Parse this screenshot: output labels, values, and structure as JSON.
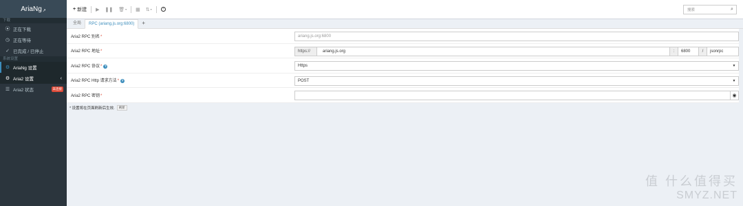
{
  "brand": {
    "name": "AriaNg",
    "suffix": "↗"
  },
  "sidebar": {
    "sections": [
      {
        "header": "下载",
        "items": [
          {
            "icon": "play-circle-icon",
            "glyph": "⦿",
            "label": "正在下载"
          },
          {
            "icon": "clock-icon",
            "glyph": "◷",
            "label": "正在等待"
          },
          {
            "icon": "check-circle-icon",
            "glyph": "✓",
            "label": "已完成 / 已停止"
          }
        ]
      },
      {
        "header": "系统设置",
        "items": [
          {
            "icon": "gear-icon",
            "glyph": "⚙",
            "label": "AriaNg 设置"
          },
          {
            "icon": "gears-icon",
            "glyph": "⚙",
            "label": "Aria2 设置"
          },
          {
            "icon": "list-icon",
            "glyph": "☰",
            "label": "Aria2 状态",
            "badge": "未连接"
          }
        ]
      }
    ]
  },
  "toolbar": {
    "new_label": "新建",
    "search_placeholder": "搜索"
  },
  "tabs": [
    "全局",
    "RPC (ariang.js.org:6800)",
    "+"
  ],
  "form": {
    "alias": {
      "label": "Aria2 RPC 别名",
      "placeholder": "ariang.js.org:6800"
    },
    "address": {
      "label": "Aria2 RPC 地址",
      "protocol": "https://",
      "host": "ariang.js.org",
      "sep1": ":",
      "port": "6800",
      "sep2": "/",
      "path": "jsonrpc"
    },
    "protocol": {
      "label": "Aria2 RPC 协议",
      "value": "Https"
    },
    "method": {
      "label": "Aria2 RPC Http 请求方法",
      "value": "POST"
    },
    "secret": {
      "label": "Aria2 RPC 密钥",
      "value": ""
    }
  },
  "note": {
    "text": "* 设置将在页面刷新后生效.",
    "button": "刷新"
  },
  "watermark": {
    "line1": "值 什么值得买",
    "line2": "SMYZ.NET"
  },
  "colors": {
    "accent": "#3c8dbc",
    "sidebar": "#2b353d",
    "danger": "#dd4b39"
  }
}
